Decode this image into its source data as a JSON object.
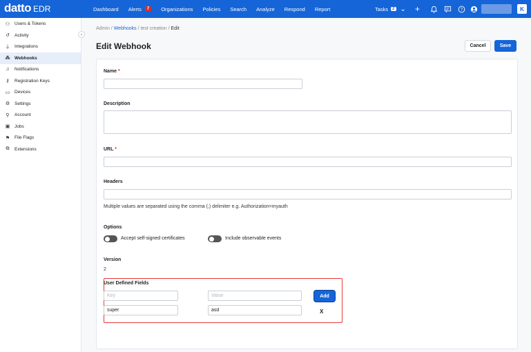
{
  "brand": {
    "logo": "datto",
    "product": "EDR"
  },
  "nav": {
    "items": [
      "Dashboard",
      "Alerts",
      "Organizations",
      "Policies",
      "Search",
      "Analyze",
      "Respond",
      "Report"
    ],
    "alerts_badge": "7"
  },
  "topright": {
    "tasks_label": "Tasks",
    "tasks_count": "2",
    "user_initial": "K"
  },
  "sidebar": {
    "items": [
      {
        "label": "Users & Tokens",
        "icon": "users-icon"
      },
      {
        "label": "Activity",
        "icon": "history-icon"
      },
      {
        "label": "Integrations",
        "icon": "plug-icon"
      },
      {
        "label": "Webhooks",
        "icon": "webhook-icon"
      },
      {
        "label": "Notifications",
        "icon": "bell-icon"
      },
      {
        "label": "Registration Keys",
        "icon": "key-icon"
      },
      {
        "label": "Devices",
        "icon": "devices-icon"
      },
      {
        "label": "Settings",
        "icon": "gear-icon"
      },
      {
        "label": "Account",
        "icon": "person-icon"
      },
      {
        "label": "Jobs",
        "icon": "briefcase-icon"
      },
      {
        "label": "File Flags",
        "icon": "flag-icon"
      },
      {
        "label": "Extensions",
        "icon": "puzzle-icon"
      }
    ],
    "active": "Webhooks"
  },
  "breadcrumb": {
    "root": "Admin",
    "section": "Webhooks",
    "item": "test creation",
    "current": "Edit"
  },
  "page": {
    "title": "Edit Webhook",
    "cancel_label": "Cancel",
    "save_label": "Save"
  },
  "form": {
    "name_label": "Name",
    "name_value": "",
    "description_label": "Description",
    "description_value": "",
    "url_label": "URL",
    "url_value": "",
    "headers_label": "Headers",
    "headers_value": "",
    "headers_help": "Multiple values are separated using the comma (,) delimiter e.g. Authorization=myauth",
    "options_label": "Options",
    "option_self_signed": "Accept self-signed certificates",
    "option_observable": "Include observable events",
    "version_label": "Version",
    "version_value": "2",
    "udf_label": "User Defined Fields",
    "udf_key_placeholder": "Key",
    "udf_value_placeholder": "Value",
    "udf_add_label": "Add",
    "udf_rows": [
      {
        "key": "super",
        "value": "asd",
        "remove_label": "X"
      }
    ]
  }
}
